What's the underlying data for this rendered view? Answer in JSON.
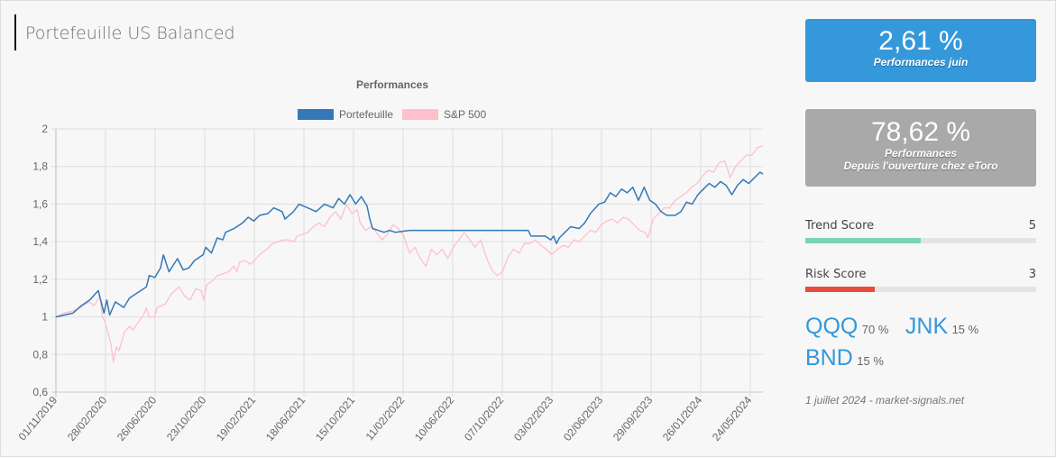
{
  "page": {
    "title": "Portefeuille US Balanced"
  },
  "cards": {
    "monthly": {
      "value": "2,61 %",
      "label": "Performances juin"
    },
    "since_open": {
      "value": "78,62 %",
      "label_line1": "Performances",
      "label_line2": "Depuis l'ouverture chez eToro"
    }
  },
  "scores": {
    "trend": {
      "label": "Trend Score",
      "value": "5",
      "fraction": 0.5,
      "color": "#7dd3b8"
    },
    "risk": {
      "label": "Risk Score",
      "value": "3",
      "fraction": 0.3,
      "color": "#e74c3c"
    }
  },
  "assets": [
    {
      "ticker": "QQQ",
      "weight": "70 %"
    },
    {
      "ticker": "JNK",
      "weight": "15 %"
    },
    {
      "ticker": "BND",
      "weight": "15 %"
    }
  ],
  "footer": "1 juillet 2024 - market-signals.net",
  "chart_data": {
    "type": "line",
    "title": "Performances",
    "legend_position": "top",
    "grid": true,
    "xlabel": "",
    "ylabel": "",
    "ylim": [
      0.6,
      2
    ],
    "y_ticks": [
      "0,6",
      "0,8",
      "1",
      "1,2",
      "1,4",
      "1,6",
      "1,8",
      "2"
    ],
    "y_tick_values": [
      0.6,
      0.8,
      1.0,
      1.2,
      1.4,
      1.6,
      1.8,
      2.0
    ],
    "x_tick_labels": [
      "01/11/2019",
      "28/02/2020",
      "26/06/2020",
      "23/10/2020",
      "19/02/2021",
      "18/06/2021",
      "15/10/2021",
      "11/02/2022",
      "10/06/2022",
      "07/10/2022",
      "03/02/2023",
      "02/06/2023",
      "29/09/2023",
      "26/01/2024",
      "24/05/2024"
    ],
    "x_tick_week_index": [
      0,
      17,
      34,
      51,
      68,
      85,
      102,
      119,
      136,
      153,
      170,
      187,
      204,
      221,
      238
    ],
    "total_weeks": 243,
    "series": [
      {
        "name": "Portefeuille",
        "color": "#3379b7",
        "keypoints": [
          [
            0,
            1.0
          ],
          [
            3,
            1.01
          ],
          [
            6,
            1.02
          ],
          [
            9,
            1.06
          ],
          [
            12,
            1.09
          ],
          [
            15,
            1.14
          ],
          [
            17,
            1.02
          ],
          [
            18,
            1.09
          ],
          [
            19,
            1.01
          ],
          [
            21,
            1.08
          ],
          [
            24,
            1.05
          ],
          [
            26,
            1.1
          ],
          [
            29,
            1.13
          ],
          [
            32,
            1.16
          ],
          [
            33,
            1.22
          ],
          [
            35,
            1.21
          ],
          [
            37,
            1.26
          ],
          [
            38,
            1.33
          ],
          [
            40,
            1.24
          ],
          [
            43,
            1.31
          ],
          [
            45,
            1.25
          ],
          [
            47,
            1.26
          ],
          [
            49,
            1.3
          ],
          [
            52,
            1.33
          ],
          [
            53,
            1.37
          ],
          [
            55,
            1.34
          ],
          [
            57,
            1.42
          ],
          [
            59,
            1.41
          ],
          [
            60,
            1.45
          ],
          [
            63,
            1.47
          ],
          [
            66,
            1.5
          ],
          [
            68,
            1.53
          ],
          [
            70,
            1.51
          ],
          [
            72,
            1.54
          ],
          [
            75,
            1.55
          ],
          [
            77,
            1.58
          ],
          [
            80,
            1.56
          ],
          [
            81,
            1.52
          ],
          [
            84,
            1.56
          ],
          [
            86,
            1.6
          ],
          [
            89,
            1.58
          ],
          [
            92,
            1.56
          ],
          [
            95,
            1.6
          ],
          [
            98,
            1.58
          ],
          [
            100,
            1.63
          ],
          [
            102,
            1.6
          ],
          [
            104,
            1.65
          ],
          [
            106,
            1.6
          ],
          [
            108,
            1.64
          ],
          [
            110,
            1.59
          ],
          [
            111,
            1.52
          ],
          [
            112,
            1.47
          ],
          [
            114,
            1.46
          ],
          [
            116,
            1.45
          ],
          [
            118,
            1.46
          ],
          [
            120,
            1.45
          ],
          [
            125,
            1.46
          ],
          [
            150,
            1.46
          ],
          [
            155,
            1.46
          ],
          [
            158,
            1.46
          ],
          [
            160,
            1.46
          ],
          [
            167,
            1.46
          ],
          [
            168,
            1.43
          ],
          [
            173,
            1.43
          ],
          [
            175,
            1.41
          ],
          [
            176,
            1.43
          ],
          [
            177,
            1.39
          ],
          [
            178,
            1.42
          ],
          [
            180,
            1.45
          ],
          [
            182,
            1.48
          ],
          [
            185,
            1.47
          ],
          [
            187,
            1.5
          ],
          [
            189,
            1.55
          ],
          [
            192,
            1.6
          ],
          [
            194,
            1.61
          ],
          [
            196,
            1.66
          ],
          [
            198,
            1.64
          ],
          [
            200,
            1.68
          ],
          [
            202,
            1.66
          ],
          [
            204,
            1.69
          ],
          [
            206,
            1.62
          ],
          [
            208,
            1.69
          ],
          [
            210,
            1.62
          ],
          [
            212,
            1.6
          ],
          [
            214,
            1.56
          ],
          [
            216,
            1.54
          ],
          [
            219,
            1.54
          ],
          [
            221,
            1.56
          ],
          [
            223,
            1.61
          ],
          [
            225,
            1.6
          ],
          [
            227,
            1.65
          ],
          [
            229,
            1.68
          ],
          [
            231,
            1.71
          ],
          [
            233,
            1.69
          ],
          [
            235,
            1.72
          ],
          [
            237,
            1.7
          ],
          [
            239,
            1.65
          ],
          [
            241,
            1.7
          ],
          [
            243,
            1.73
          ],
          [
            245,
            1.71
          ],
          [
            247,
            1.74
          ],
          [
            249,
            1.77
          ],
          [
            250,
            1.76
          ]
        ]
      },
      {
        "name": "S&P 500",
        "color": "#ffc0cb",
        "keypoints": [
          [
            0,
            1.0
          ],
          [
            3,
            1.02
          ],
          [
            6,
            1.03
          ],
          [
            9,
            1.05
          ],
          [
            12,
            1.08
          ],
          [
            14,
            1.06
          ],
          [
            16,
            1.11
          ],
          [
            17,
            1.0
          ],
          [
            18,
            0.97
          ],
          [
            20,
            0.86
          ],
          [
            21,
            0.76
          ],
          [
            22,
            0.84
          ],
          [
            23,
            0.82
          ],
          [
            25,
            0.92
          ],
          [
            27,
            0.95
          ],
          [
            28,
            0.93
          ],
          [
            30,
            0.97
          ],
          [
            32,
            1.01
          ],
          [
            33,
            1.05
          ],
          [
            34,
            1.0
          ],
          [
            36,
            1.0
          ],
          [
            37,
            1.05
          ],
          [
            40,
            1.07
          ],
          [
            42,
            1.12
          ],
          [
            45,
            1.16
          ],
          [
            47,
            1.11
          ],
          [
            49,
            1.09
          ],
          [
            51,
            1.15
          ],
          [
            53,
            1.14
          ],
          [
            54,
            1.09
          ],
          [
            55,
            1.17
          ],
          [
            57,
            1.19
          ],
          [
            59,
            1.22
          ],
          [
            61,
            1.23
          ],
          [
            63,
            1.24
          ],
          [
            65,
            1.27
          ],
          [
            66,
            1.24
          ],
          [
            67,
            1.29
          ],
          [
            69,
            1.3
          ],
          [
            71,
            1.28
          ],
          [
            73,
            1.31
          ],
          [
            75,
            1.34
          ],
          [
            77,
            1.36
          ],
          [
            79,
            1.39
          ],
          [
            81,
            1.4
          ],
          [
            83,
            1.41
          ],
          [
            85,
            1.41
          ],
          [
            87,
            1.4
          ],
          [
            88,
            1.43
          ],
          [
            90,
            1.44
          ],
          [
            92,
            1.45
          ],
          [
            94,
            1.48
          ],
          [
            96,
            1.5
          ],
          [
            98,
            1.48
          ],
          [
            100,
            1.53
          ],
          [
            102,
            1.56
          ],
          [
            104,
            1.52
          ],
          [
            106,
            1.6
          ],
          [
            108,
            1.55
          ],
          [
            110,
            1.57
          ],
          [
            111,
            1.5
          ],
          [
            113,
            1.46
          ],
          [
            115,
            1.48
          ],
          [
            117,
            1.45
          ],
          [
            119,
            1.41
          ],
          [
            121,
            1.44
          ],
          [
            123,
            1.49
          ],
          [
            125,
            1.47
          ],
          [
            127,
            1.43
          ],
          [
            129,
            1.34
          ],
          [
            131,
            1.37
          ],
          [
            133,
            1.31
          ],
          [
            135,
            1.27
          ],
          [
            137,
            1.36
          ],
          [
            139,
            1.33
          ],
          [
            141,
            1.36
          ],
          [
            143,
            1.31
          ],
          [
            145,
            1.37
          ],
          [
            147,
            1.41
          ],
          [
            149,
            1.45
          ],
          [
            151,
            1.41
          ],
          [
            153,
            1.37
          ],
          [
            155,
            1.41
          ],
          [
            157,
            1.32
          ],
          [
            159,
            1.25
          ],
          [
            161,
            1.22
          ],
          [
            163,
            1.24
          ],
          [
            165,
            1.32
          ],
          [
            167,
            1.36
          ],
          [
            169,
            1.34
          ],
          [
            171,
            1.39
          ],
          [
            173,
            1.39
          ],
          [
            175,
            1.41
          ],
          [
            177,
            1.38
          ],
          [
            179,
            1.36
          ],
          [
            181,
            1.33
          ],
          [
            183,
            1.36
          ],
          [
            185,
            1.38
          ],
          [
            187,
            1.37
          ],
          [
            189,
            1.41
          ],
          [
            191,
            1.4
          ],
          [
            193,
            1.43
          ],
          [
            195,
            1.46
          ],
          [
            197,
            1.45
          ],
          [
            199,
            1.49
          ],
          [
            201,
            1.51
          ],
          [
            203,
            1.52
          ],
          [
            205,
            1.5
          ],
          [
            207,
            1.53
          ],
          [
            209,
            1.52
          ],
          [
            211,
            1.49
          ],
          [
            213,
            1.46
          ],
          [
            215,
            1.45
          ],
          [
            216,
            1.42
          ],
          [
            218,
            1.52
          ],
          [
            220,
            1.55
          ],
          [
            222,
            1.58
          ],
          [
            224,
            1.58
          ],
          [
            226,
            1.62
          ],
          [
            228,
            1.64
          ],
          [
            230,
            1.66
          ],
          [
            232,
            1.69
          ],
          [
            234,
            1.71
          ],
          [
            236,
            1.75
          ],
          [
            238,
            1.78
          ],
          [
            240,
            1.77
          ],
          [
            242,
            1.82
          ],
          [
            244,
            1.83
          ],
          [
            245,
            1.79
          ],
          [
            246,
            1.74
          ],
          [
            248,
            1.8
          ],
          [
            250,
            1.83
          ],
          [
            252,
            1.86
          ],
          [
            254,
            1.86
          ],
          [
            256,
            1.9
          ],
          [
            258,
            1.91
          ]
        ]
      }
    ]
  }
}
